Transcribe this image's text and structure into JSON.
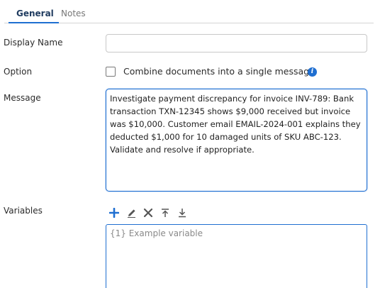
{
  "tabs": [
    {
      "label": "General",
      "active": true
    },
    {
      "label": "Notes",
      "active": false
    }
  ],
  "fields": {
    "display_name": {
      "label": "Display Name",
      "value": "",
      "placeholder": ""
    },
    "option": {
      "label": "Option",
      "checkbox_label": "Combine documents into a single message",
      "checked": false,
      "info_icon": "info-icon"
    },
    "message": {
      "label": "Message",
      "value": "Investigate payment discrepancy for invoice INV-789: Bank transaction TXN-12345 shows $9,000 received but invoice was $10,000. Customer email EMAIL-2024-001 explains they deducted $1,000 for 10 damaged units of SKU ABC-123. Validate and resolve if appropriate."
    },
    "variables": {
      "label": "Variables",
      "placeholder": "{1} Example variable",
      "toolbar": [
        "add-icon",
        "edit-icon",
        "delete-icon",
        "move-up-icon",
        "move-down-icon"
      ]
    }
  },
  "colors": {
    "accent": "#1f6fd1",
    "tab_active_text": "#1f3b5f",
    "tab_inactive_text": "#777777",
    "border": "#c8c8c8",
    "icon_gray": "#555555"
  }
}
